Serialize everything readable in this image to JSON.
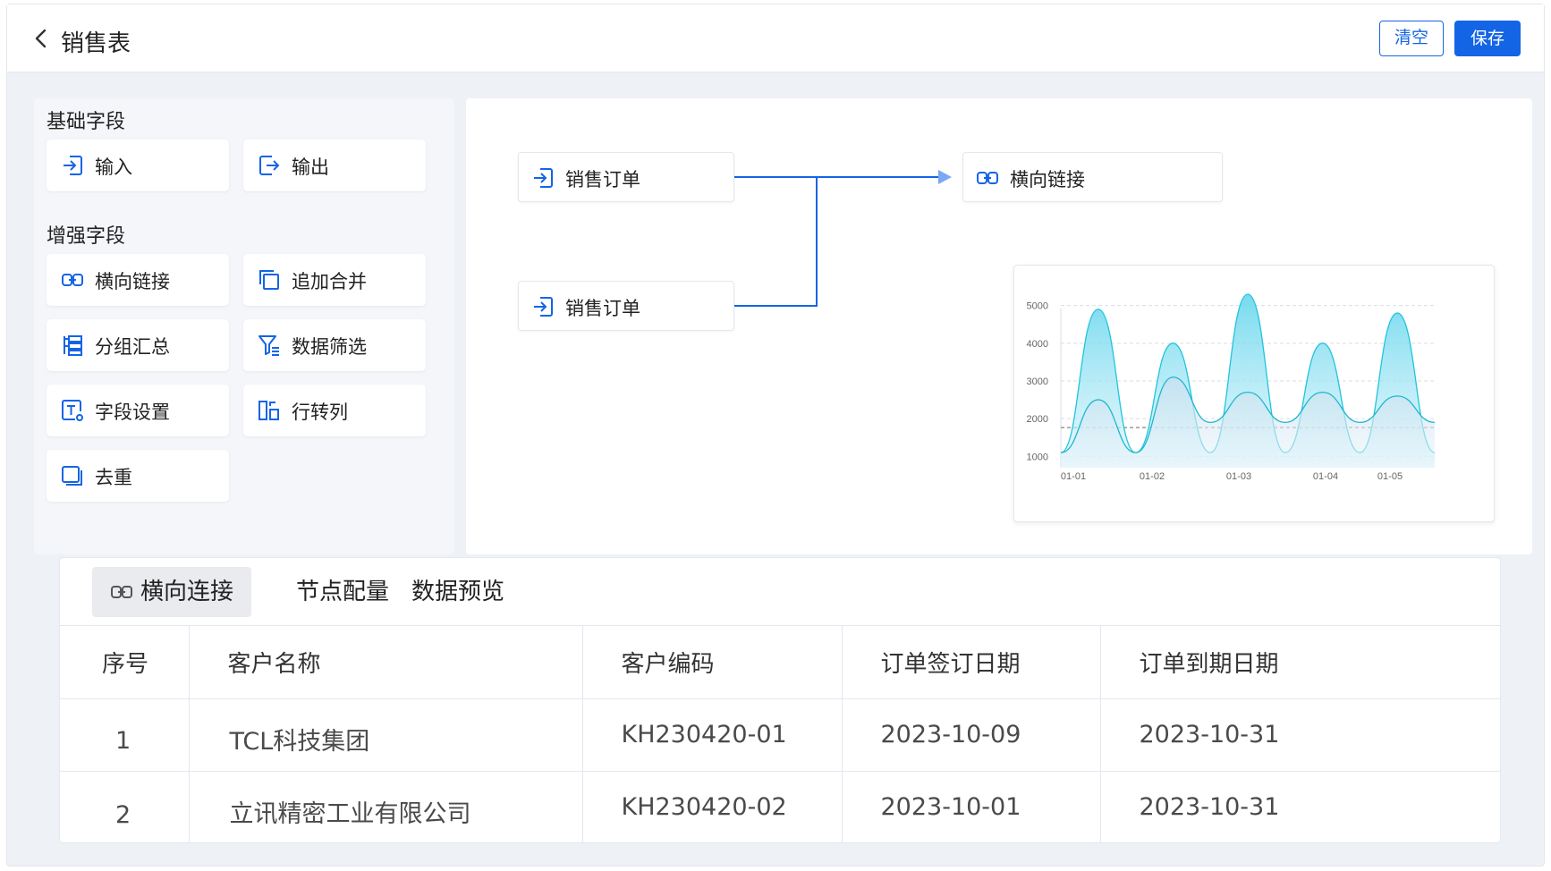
{
  "header": {
    "back_icon": "chevron-left-icon",
    "title": "销售表",
    "clear_label": "清空",
    "save_label": "保存"
  },
  "colors": {
    "primary": "#1464e6",
    "chart_cyan": "#21c4dd",
    "chart_fill": "#9fe4f2"
  },
  "sidebar": {
    "basic_title": "基础字段",
    "basic_items": [
      {
        "label": "输入",
        "icon": "input-icon"
      },
      {
        "label": "输出",
        "icon": "output-icon"
      }
    ],
    "enhanced_title": "增强字段",
    "enhanced_items": [
      {
        "label": "横向链接",
        "icon": "link-icon"
      },
      {
        "label": "追加合并",
        "icon": "copy-merge-icon"
      },
      {
        "label": "分组汇总",
        "icon": "group-summary-icon"
      },
      {
        "label": "数据筛选",
        "icon": "filter-icon"
      },
      {
        "label": "字段设置",
        "icon": "field-settings-icon"
      },
      {
        "label": "行转列",
        "icon": "row-to-column-icon"
      },
      {
        "label": "去重",
        "icon": "dedupe-icon"
      }
    ]
  },
  "flow": {
    "nodes": [
      {
        "label": "销售订单",
        "icon": "input-icon"
      },
      {
        "label": "销售订单",
        "icon": "input-icon"
      },
      {
        "label": "横向链接",
        "icon": "link-icon"
      }
    ]
  },
  "chart_data": {
    "type": "area",
    "title": "",
    "xlabel": "",
    "ylabel": "",
    "y_ticks": [
      "5000",
      "4000",
      "3000",
      "2000",
      "1000"
    ],
    "x_ticks": [
      "01-01",
      "01-02",
      "01-03",
      "01-04",
      "01-05"
    ],
    "ylim": [
      700,
      5300
    ],
    "grid": "dashed horizontal",
    "series": [
      {
        "values": [
          1100,
          4900,
          1100,
          4000,
          1100,
          5300,
          1100,
          4000,
          1100,
          4800,
          1100
        ]
      },
      {
        "values": [
          1100,
          2500,
          1100,
          3100,
          1900,
          2700,
          1900,
          2700,
          1900,
          2600,
          1900
        ]
      }
    ],
    "reference_lines": [
      2000
    ]
  },
  "bottom": {
    "tabs": [
      {
        "label": "横向连接",
        "icon": "link-icon"
      },
      {
        "label": "节点配量"
      },
      {
        "label": "数据预览"
      }
    ],
    "table": {
      "columns": [
        "序号",
        "客户名称",
        "客户编码",
        "订单签订日期",
        "订单到期日期"
      ],
      "rows": [
        [
          "1",
          "TCL科技集团",
          "KH230420-01",
          "2023-10-09",
          "2023-10-31"
        ],
        [
          "2",
          "立讯精密工业有限公司",
          "KH230420-02",
          "2023-10-01",
          "2023-10-31"
        ]
      ]
    }
  }
}
